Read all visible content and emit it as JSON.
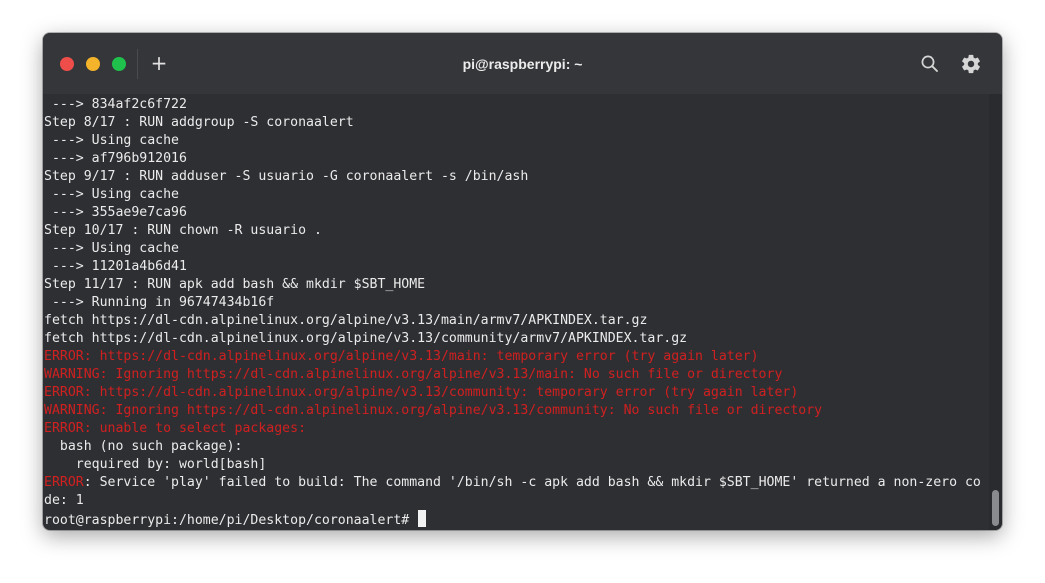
{
  "window": {
    "title": "pi@raspberrypi: ~",
    "new_tab_label": "+"
  },
  "icons": {
    "new_tab": "plus-icon",
    "search": "search-icon",
    "settings": "gear-icon"
  },
  "colors": {
    "background": "#2e2f33",
    "titlebar": "#353639",
    "text": "#ebebeb",
    "error": "#d02020",
    "close": "#ee4d4a",
    "minimize": "#f3b32a",
    "maximize": "#1fc14c"
  },
  "terminal": {
    "lines": [
      " ---> 834af2c6f722",
      "Step 8/17 : RUN addgroup -S coronaalert",
      " ---> Using cache",
      " ---> af796b912016",
      "Step 9/17 : RUN adduser -S usuario -G coronaalert -s /bin/ash",
      " ---> Using cache",
      " ---> 355ae9e7ca96",
      "Step 10/17 : RUN chown -R usuario .",
      " ---> Using cache",
      " ---> 11201a4b6d41",
      "Step 11/17 : RUN apk add bash && mkdir $SBT_HOME",
      " ---> Running in 96747434b16f",
      "fetch https://dl-cdn.alpinelinux.org/alpine/v3.13/main/armv7/APKINDEX.tar.gz",
      "fetch https://dl-cdn.alpinelinux.org/alpine/v3.13/community/armv7/APKINDEX.tar.gz",
      "ERROR: https://dl-cdn.alpinelinux.org/alpine/v3.13/main: temporary error (try again later)",
      "WARNING: Ignoring https://dl-cdn.alpinelinux.org/alpine/v3.13/main: No such file or directory",
      "ERROR: https://dl-cdn.alpinelinux.org/alpine/v3.13/community: temporary error (try again later)",
      "WARNING: Ignoring https://dl-cdn.alpinelinux.org/alpine/v3.13/community: No such file or directory",
      "ERROR: unable to select packages:",
      "  bash (no such package):",
      "    required by: world[bash]"
    ],
    "failure_prefix": "ERROR",
    "failure_message": ": Service 'play' failed to build: The command '/bin/sh -c apk add bash && mkdir $SBT_HOME' returned a non-zero co",
    "failure_continuation": "de: 1",
    "prompt": "root@raspberrypi:/home/pi/Desktop/coronaalert# "
  }
}
